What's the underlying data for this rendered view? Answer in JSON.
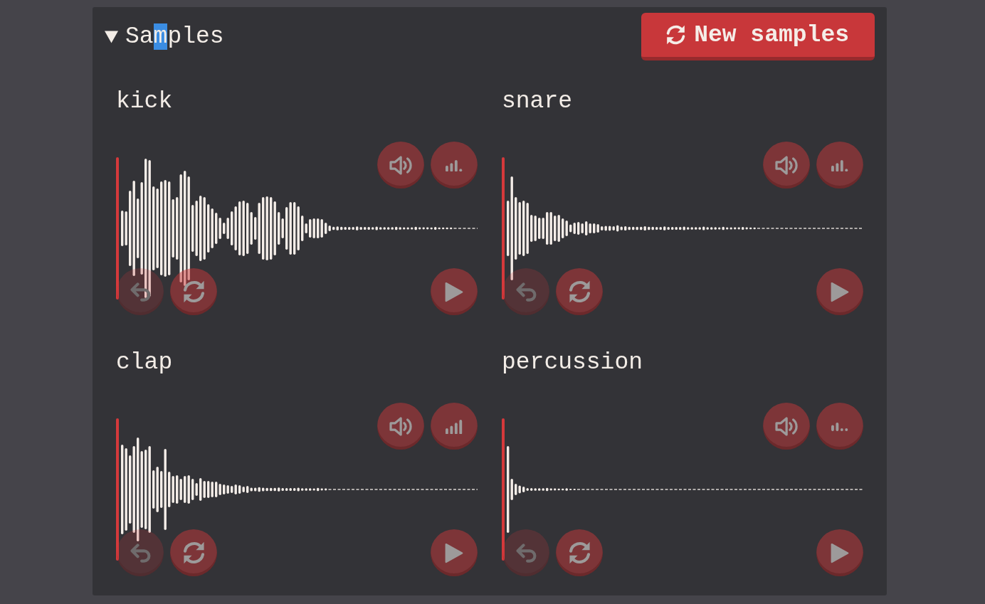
{
  "section": {
    "expanded": true,
    "title_parts": [
      {
        "text": "Sa",
        "selected": false
      },
      {
        "text": "m",
        "selected": true
      },
      {
        "text": "ples",
        "selected": false
      }
    ]
  },
  "new_samples_button": {
    "label": "New samples"
  },
  "samples": [
    {
      "name": "kick",
      "level": 0.75,
      "undo": {
        "disabled": true
      }
    },
    {
      "name": "snare",
      "level": 0.75,
      "undo": {
        "disabled": true
      }
    },
    {
      "name": "clap",
      "level": 1,
      "undo": {
        "disabled": true
      }
    },
    {
      "name": "percussion",
      "level": 0.5,
      "undo": {
        "disabled": true
      }
    }
  ]
}
